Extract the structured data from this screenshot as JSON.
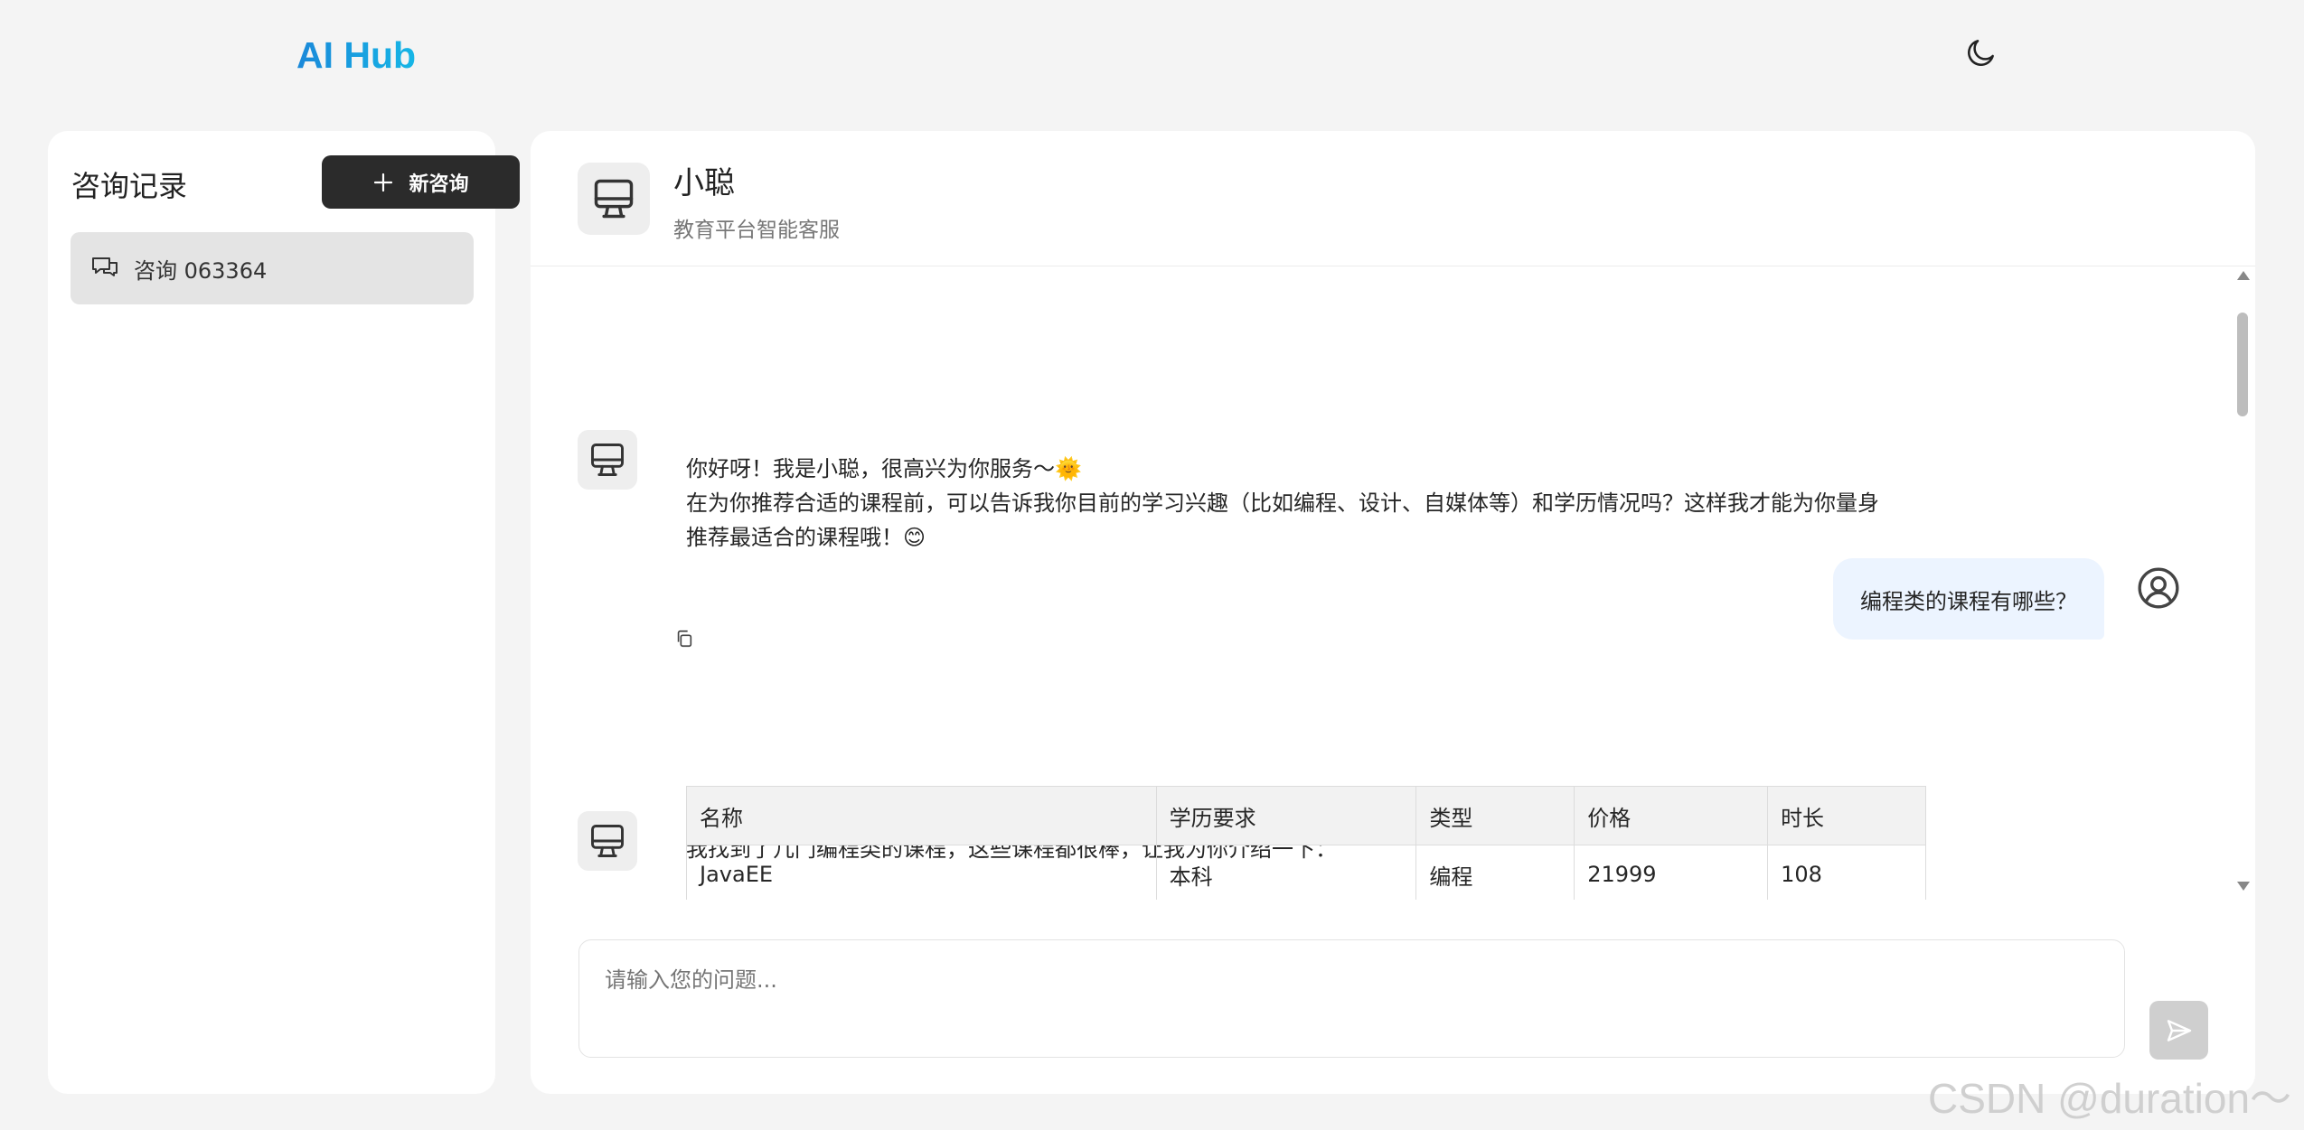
{
  "app": {
    "logo": "AI Hub"
  },
  "header": {
    "theme_icon": "moon-icon"
  },
  "sidebar": {
    "title": "咨询记录",
    "new_button_label": "新咨询",
    "items": [
      {
        "label": "咨询 063364",
        "icon": "chat-bubbles-icon",
        "active": true
      }
    ]
  },
  "assistant": {
    "name": "小聪",
    "subtitle": "教育平台智能客服"
  },
  "messages": [
    {
      "role": "assistant",
      "text": "你好呀！我是小聪，很高兴为你服务〜🌞\n在为你推荐合适的课程前，可以告诉我你目前的学习兴趣（比如编程、设计、自媒体等）和学历情况吗？这样我才能为你量身\n推荐最适合的课程哦！😊"
    },
    {
      "role": "user",
      "text": "编程类的课程有哪些？"
    },
    {
      "role": "assistant",
      "text": "我找到了几门编程类的课程，这些课程都很棒，让我为你介绍一下："
    }
  ],
  "course_table": {
    "headers": [
      "名称",
      "学历要求",
      "类型",
      "价格",
      "时长"
    ],
    "rows": [
      [
        "JavaEE",
        "本科",
        "编程",
        "21999",
        "108"
      ]
    ]
  },
  "input": {
    "placeholder": "请输入您的问题..."
  },
  "watermark": "CSDN @duration～",
  "colors": {
    "logo_gradient_start": "#1a88d9",
    "logo_gradient_end": "#16b6e6",
    "new_button_bg": "#2b2b2b",
    "user_bubble_bg": "#ecf4ff"
  }
}
